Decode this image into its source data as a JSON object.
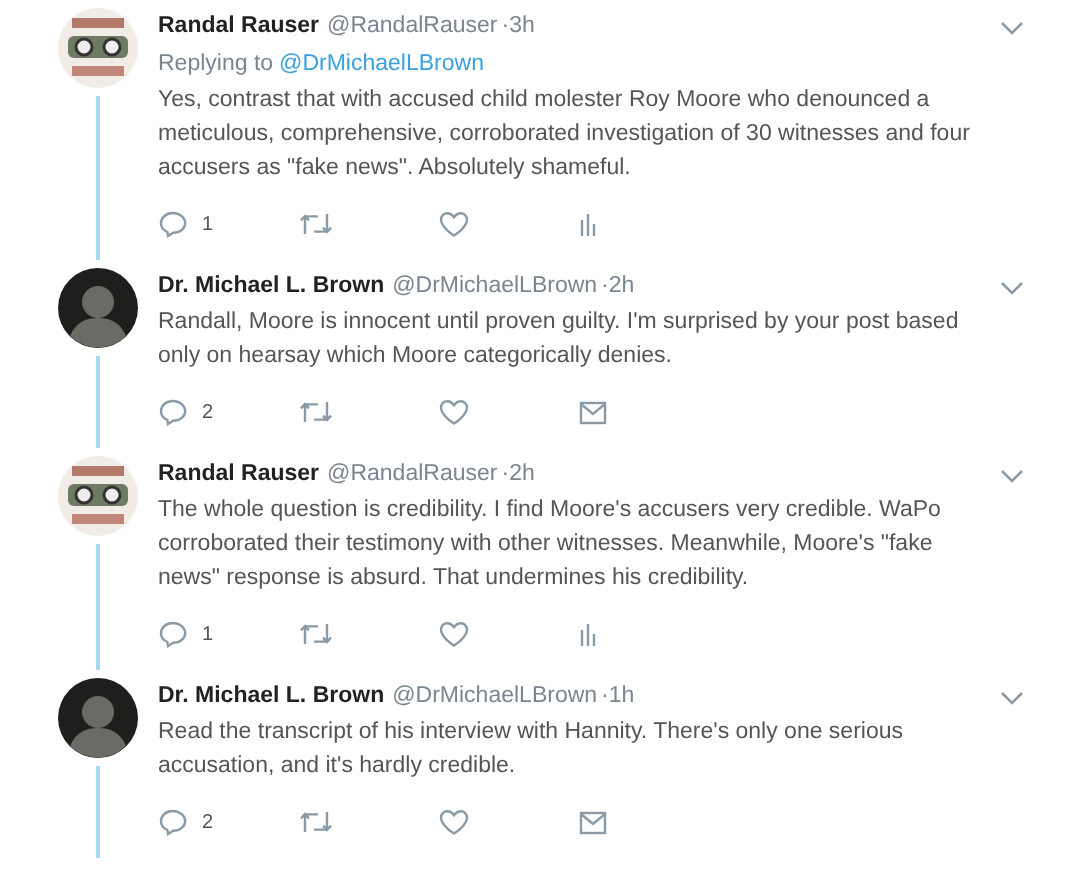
{
  "tweets": [
    {
      "name": "Randal Rauser",
      "handle": "@RandalRauser",
      "time": "·3h",
      "avatar": {
        "kind": "logo"
      },
      "replying_to": {
        "label": "Replying to",
        "handle": "@DrMichaelLBrown"
      },
      "text": "Yes, contrast that with accused child molester Roy Moore who denounced a meticulous, comprehensive, corroborated investigation of 30 witnesses and four accusers as \"fake news\". Absolutely shameful.",
      "reply_count": "1",
      "last_action": {
        "kind": "analytics"
      }
    },
    {
      "name": "Dr. Michael L. Brown",
      "handle": "@DrMichaelLBrown",
      "time": "·2h",
      "avatar": {
        "kind": "photo"
      },
      "text": "Randall, Moore is innocent until proven guilty. I'm surprised by your post based only on hearsay which Moore categorically denies.",
      "reply_count": "2",
      "last_action": {
        "kind": "message"
      }
    },
    {
      "name": "Randal Rauser",
      "handle": "@RandalRauser",
      "time": "·2h",
      "avatar": {
        "kind": "logo"
      },
      "text": "The whole question is credibility. I find Moore's accusers very credible. WaPo corroborated their testimony with other witnesses. Meanwhile, Moore's \"fake news\" response is absurd. That undermines his credibility.",
      "reply_count": "1",
      "last_action": {
        "kind": "analytics"
      }
    },
    {
      "name": "Dr. Michael L. Brown",
      "handle": "@DrMichaelLBrown",
      "time": "·1h",
      "avatar": {
        "kind": "photo"
      },
      "text": "Read the transcript of his interview with Hannity. There's only one serious accusation, and it's hardly credible.",
      "reply_count": "2",
      "last_action": {
        "kind": "message"
      }
    }
  ]
}
